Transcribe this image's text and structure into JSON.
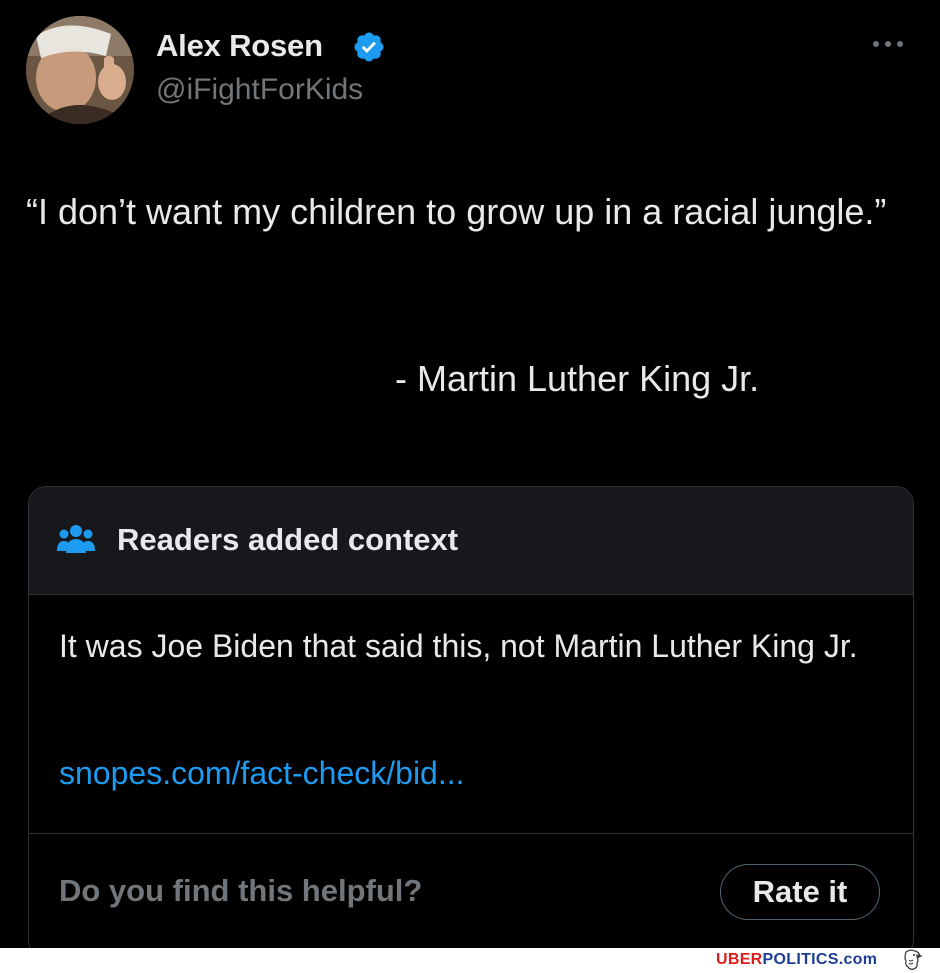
{
  "author": {
    "name": "Alex Rosen",
    "handle": "@iFightForKids",
    "verified": true,
    "avatar_icon": "profile-photo"
  },
  "post": {
    "text": "“I don’t want my children to grow up in a racial jungle.”",
    "attribution": "- Martin Luther King Jr."
  },
  "community_note": {
    "title": "Readers added context",
    "icon": "readers-icon",
    "body": "It was Joe Biden that said this, not Martin Luther King Jr.",
    "link_text": "snopes.com/fact-check/bid...",
    "helpful_question": "Do you find this helpful?",
    "rate_button_label": "Rate it"
  },
  "watermark": {
    "part1": "UBER",
    "part2": "POLITICS",
    "part3": ".com"
  },
  "colors": {
    "background": "#000000",
    "text_primary": "#e7e9ea",
    "text_secondary": "#71767b",
    "link": "#1d9bf0",
    "verified": "#1d9bf0",
    "note_header_bg": "#16181c",
    "border": "#2f3336"
  }
}
